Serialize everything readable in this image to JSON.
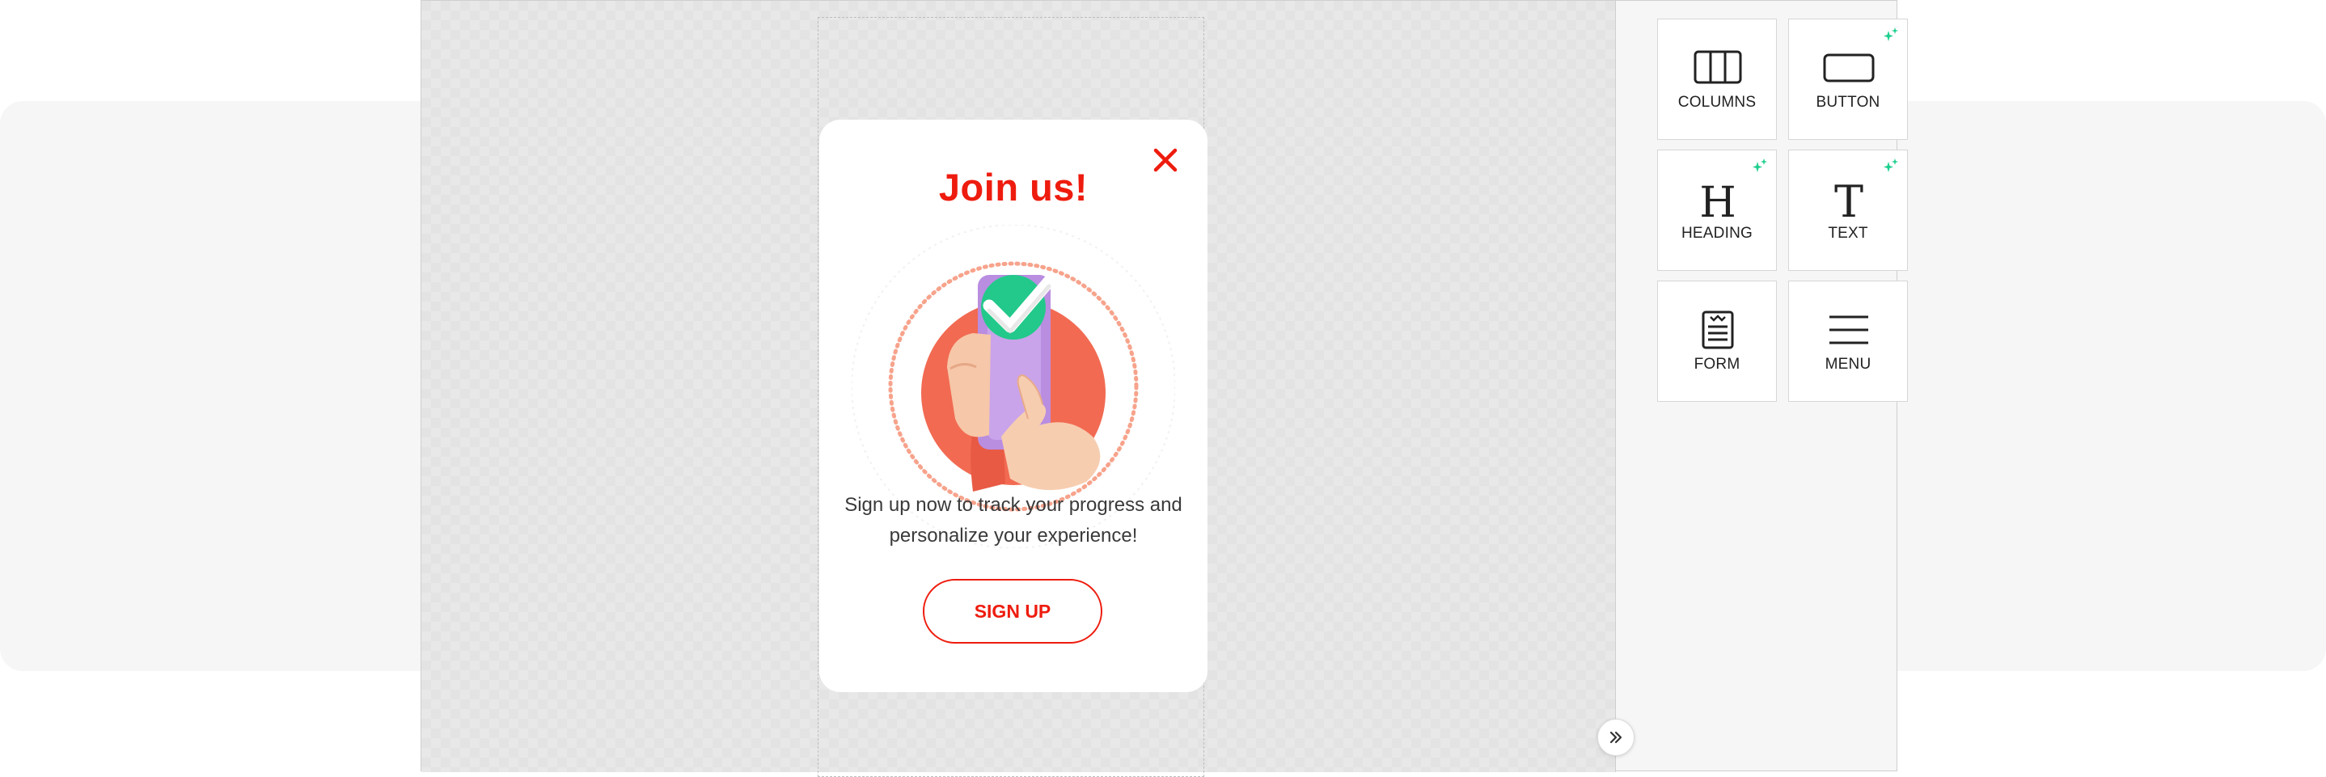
{
  "popup": {
    "title": "Join us!",
    "description": "Sign up now to track your progress and personalize your experience!",
    "cta_label": "SIGN UP",
    "accent_color": "#ee1c0e",
    "close_icon": "close-icon"
  },
  "panel": {
    "tiles": [
      {
        "label": "COLUMNS",
        "icon": "columns-icon",
        "ai": false
      },
      {
        "label": "BUTTON",
        "icon": "button-icon",
        "ai": true
      },
      {
        "label": "HEADING",
        "icon": "heading-icon",
        "ai": true
      },
      {
        "label": "TEXT",
        "icon": "text-icon",
        "ai": true
      },
      {
        "label": "FORM",
        "icon": "form-icon",
        "ai": false
      },
      {
        "label": "MENU",
        "icon": "menu-icon",
        "ai": false
      }
    ],
    "ai_badge_color": "#1fcf8f",
    "collapse_icon": "double-chevron-right-icon"
  }
}
